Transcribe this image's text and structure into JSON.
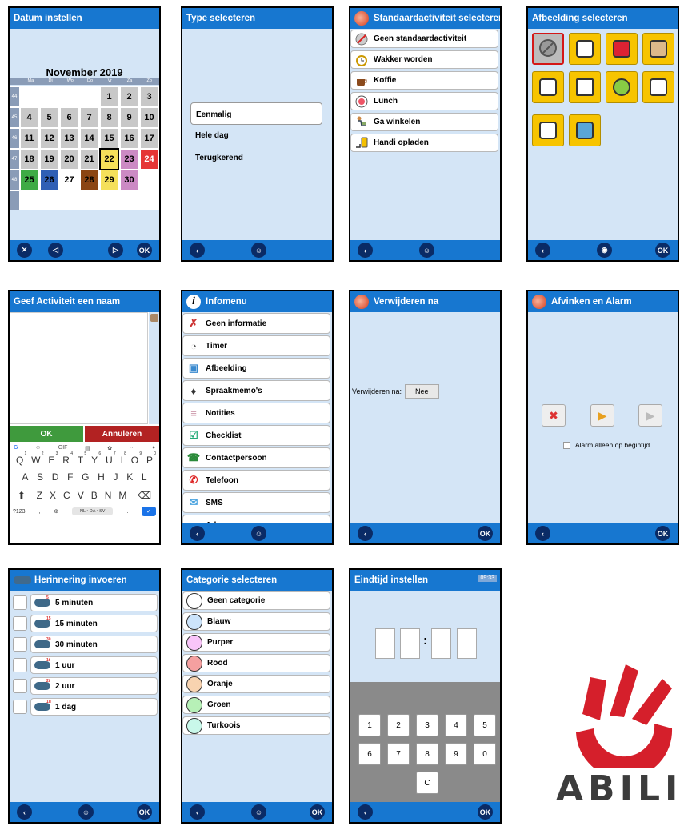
{
  "screens": {
    "datum": {
      "title": "Datum instellen",
      "month": "November 2019",
      "weekdays": [
        "Ma",
        "Di",
        "Wo",
        "Do",
        "Vr",
        "Za",
        "Zo"
      ],
      "weeks": [
        "44",
        "45",
        "46",
        "47",
        "48"
      ],
      "bottom": {
        "ok": "OK"
      }
    },
    "type": {
      "title": "Type selecteren",
      "options": [
        "Eenmalig",
        "Hele dag",
        "Terugkerend"
      ]
    },
    "standaard": {
      "title": "Standaardactiviteit selecteren",
      "items": [
        "Geen standaardactiviteit",
        "Wakker worden",
        "Koffie",
        "Lunch",
        "Ga winkelen",
        "Handi opladen"
      ]
    },
    "afbeelding": {
      "title": "Afbeelding selecteren",
      "ok": "OK"
    },
    "naam": {
      "title": "Geef Activiteit een naam",
      "ok": "OK",
      "cancel": "Annuleren",
      "keys_row1": [
        "Q",
        "W",
        "E",
        "R",
        "T",
        "Y",
        "U",
        "I",
        "O",
        "P"
      ],
      "key_hints": [
        "1",
        "2",
        "3",
        "4",
        "5",
        "6",
        "7",
        "8",
        "9",
        "0"
      ],
      "keys_row2": [
        "A",
        "S",
        "D",
        "F",
        "G",
        "H",
        "J",
        "K",
        "L"
      ],
      "keys_row3": [
        "Z",
        "X",
        "C",
        "V",
        "B",
        "N",
        "M"
      ],
      "key_123": "?123",
      "lang": "NL • DA • SV",
      "gif": "GIF",
      "dot": ".",
      "comma": ","
    },
    "info": {
      "title": "Infomenu",
      "items": [
        "Geen informatie",
        "Timer",
        "Afbeelding",
        "Spraakmemo's",
        "Notities",
        "Checklist",
        "Contactpersoon",
        "Telefoon",
        "SMS",
        "Adres"
      ]
    },
    "verwijderen": {
      "title": "Verwijderen na",
      "label": "Verwijderen na:",
      "value": "Nee",
      "ok": "OK"
    },
    "alarm": {
      "title": "Afvinken en Alarm",
      "checkbox_label": "Alarm alleen op begintijd",
      "ok": "OK"
    },
    "herinnering": {
      "title": "Herinnering invoeren",
      "items": [
        "5 minuten",
        "15 minuten",
        "30 minuten",
        "1 uur",
        "2 uur",
        "1 dag"
      ],
      "badges": [
        "5",
        "15",
        "30",
        "1t",
        "2t",
        "1d"
      ],
      "ok": "OK"
    },
    "categorie": {
      "title": "Categorie selecteren",
      "items": [
        "Geen categorie",
        "Blauw",
        "Purper",
        "Rood",
        "Oranje",
        "Groen",
        "Turkoois"
      ],
      "colors": [
        "#ffffff",
        "#cce4fb",
        "#f9c5f9",
        "#f5a0a0",
        "#f8d3b0",
        "#b7f0b7",
        "#c9f8ea"
      ],
      "ok": "OK"
    },
    "eindtijd": {
      "title": "Eindtijd instellen",
      "time": "09:33",
      "colon": ":",
      "keys": [
        "1",
        "2",
        "3",
        "4",
        "5",
        "6",
        "7",
        "8",
        "9",
        "0",
        "C"
      ],
      "ok": "OK"
    }
  },
  "logo": {
    "text": "ABILI",
    "color": "#d51f2b"
  }
}
